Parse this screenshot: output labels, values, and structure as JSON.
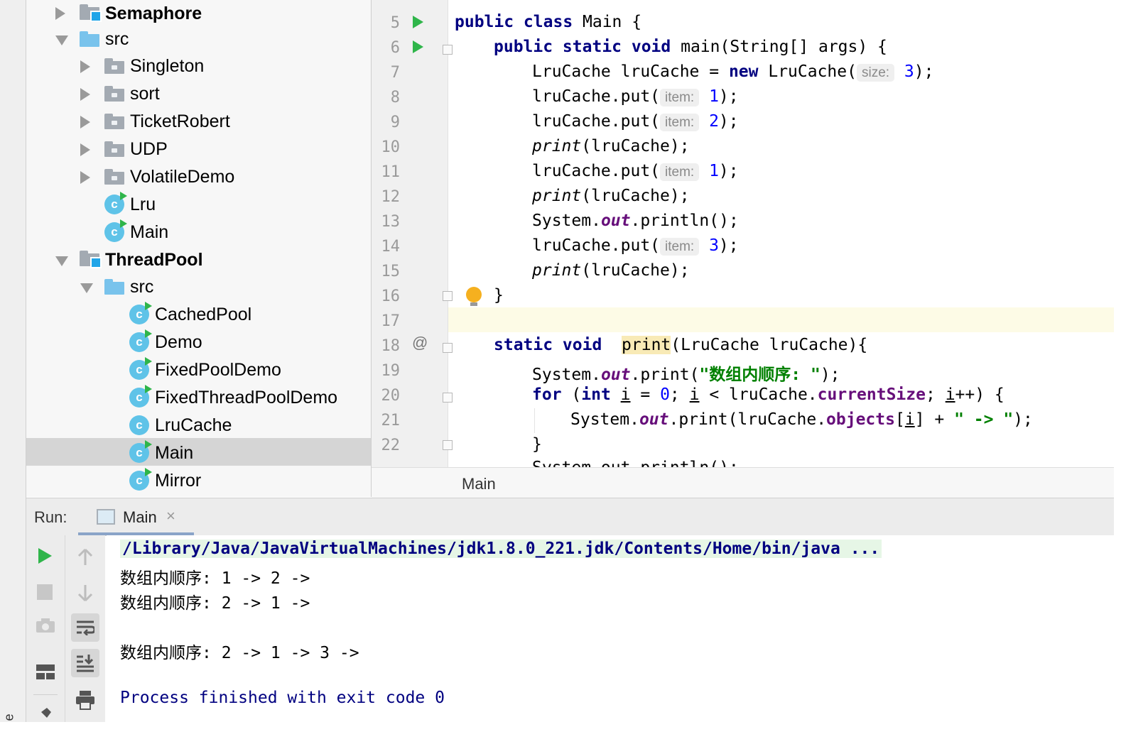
{
  "side_strip": {
    "label": "e"
  },
  "tree": {
    "items": [
      {
        "label": "Semaphore",
        "kind": "module",
        "expanded": false
      },
      {
        "label": "src",
        "kind": "src-folder",
        "expanded": true
      },
      {
        "label": "Singleton",
        "kind": "package",
        "expanded": false
      },
      {
        "label": "sort",
        "kind": "package",
        "expanded": false
      },
      {
        "label": "TicketRobert",
        "kind": "package",
        "expanded": false
      },
      {
        "label": "UDP",
        "kind": "package",
        "expanded": false
      },
      {
        "label": "VolatileDemo",
        "kind": "package",
        "expanded": false
      },
      {
        "label": "Lru",
        "kind": "runnable-class"
      },
      {
        "label": "Main",
        "kind": "runnable-class"
      },
      {
        "label": "ThreadPool",
        "kind": "module",
        "expanded": true
      },
      {
        "label": "src",
        "kind": "src-folder",
        "expanded": true
      },
      {
        "label": "CachedPool",
        "kind": "runnable-class"
      },
      {
        "label": "Demo",
        "kind": "runnable-class"
      },
      {
        "label": "FixedPoolDemo",
        "kind": "runnable-class"
      },
      {
        "label": "FixedThreadPoolDemo",
        "kind": "runnable-class"
      },
      {
        "label": "LruCache",
        "kind": "class"
      },
      {
        "label": "Main",
        "kind": "runnable-class",
        "selected": true
      },
      {
        "label": "Mirror",
        "kind": "runnable-class"
      }
    ]
  },
  "editor": {
    "lines": [
      {
        "n": "5"
      },
      {
        "n": "6"
      },
      {
        "n": "7"
      },
      {
        "n": "8"
      },
      {
        "n": "9"
      },
      {
        "n": "10"
      },
      {
        "n": "11"
      },
      {
        "n": "12"
      },
      {
        "n": "13"
      },
      {
        "n": "14"
      },
      {
        "n": "15"
      },
      {
        "n": "16"
      },
      {
        "n": "17"
      },
      {
        "n": "18"
      },
      {
        "n": "19"
      },
      {
        "n": "20"
      },
      {
        "n": "21"
      },
      {
        "n": "22"
      }
    ],
    "code": {
      "l5": {
        "kw1": "public class ",
        "name": "Main",
        "rest": " {"
      },
      "l6": {
        "kw": "public static void ",
        "rest": "main(String[] args) {"
      },
      "l7": {
        "a": "LruCache lruCache = ",
        "kw": "new",
        "b": " LruCache(",
        "hint": "size:",
        "num": "3",
        "c": ");"
      },
      "l8": {
        "a": "lruCache.put(",
        "hint": "item:",
        "num": "1",
        "c": ");"
      },
      "l9": {
        "a": "lruCache.put(",
        "hint": "item:",
        "num": "2",
        "c": ");"
      },
      "l10": {
        "fn": "print",
        "rest": "(lruCache);"
      },
      "l11": {
        "a": "lruCache.put(",
        "hint": "item:",
        "num": "1",
        "c": ");"
      },
      "l12": {
        "fn": "print",
        "rest": "(lruCache);"
      },
      "l13": {
        "a": "System.",
        "fld": "out",
        "rest": ".println();"
      },
      "l14": {
        "a": "lruCache.put(",
        "hint": "item:",
        "num": "3",
        "c": ");"
      },
      "l15": {
        "fn": "print",
        "rest": "(lruCache);"
      },
      "l16": {
        "rest": "}"
      },
      "l18": {
        "kw": "static void ",
        "fn": "print",
        "rest": "(LruCache lruCache){"
      },
      "l19": {
        "a": "System.",
        "fld": "out",
        "b": ".print(",
        "str": "\"数组内顺序: \"",
        "c": ");"
      },
      "l20": {
        "kw1": "for",
        "a": " (",
        "kw2": "int",
        "b": " ",
        "v1": "i",
        "c": " = ",
        "num": "0",
        "d": "; ",
        "v2": "i",
        "e": " < lruCache.",
        "fld": "currentSize",
        "f": "; ",
        "v3": "i",
        "g": "++) {"
      },
      "l21": {
        "a": "System.",
        "fld1": "out",
        "b": ".print(lruCache.",
        "fld2": "objects",
        "c": "[",
        "v": "i",
        "d": "] + ",
        "str": "\" -> \"",
        "e": ");"
      },
      "l22": {
        "rest": "}"
      },
      "l23": {
        "partial": "System.out.println();"
      }
    },
    "at_marker": "@",
    "breadcrumb": "Main"
  },
  "run": {
    "label": "Run:",
    "tab_label": "Main",
    "tab_close": "×",
    "console": [
      "/Library/Java/JavaVirtualMachines/jdk1.8.0_221.jdk/Contents/Home/bin/java ...",
      "数组内顺序: 1 -> 2 -> ",
      "数组内顺序: 2 -> 1 -> ",
      "",
      "数组内顺序: 2 -> 1 -> 3 -> ",
      "",
      "Process finished with exit code 0"
    ]
  },
  "colors": {
    "keyword": "#000080",
    "number": "#0000ff",
    "string": "#008000",
    "field": "#660e7a",
    "run_green": "#2fb54a",
    "selection": "#d5d5d5",
    "current_line": "#fdfbe6"
  }
}
